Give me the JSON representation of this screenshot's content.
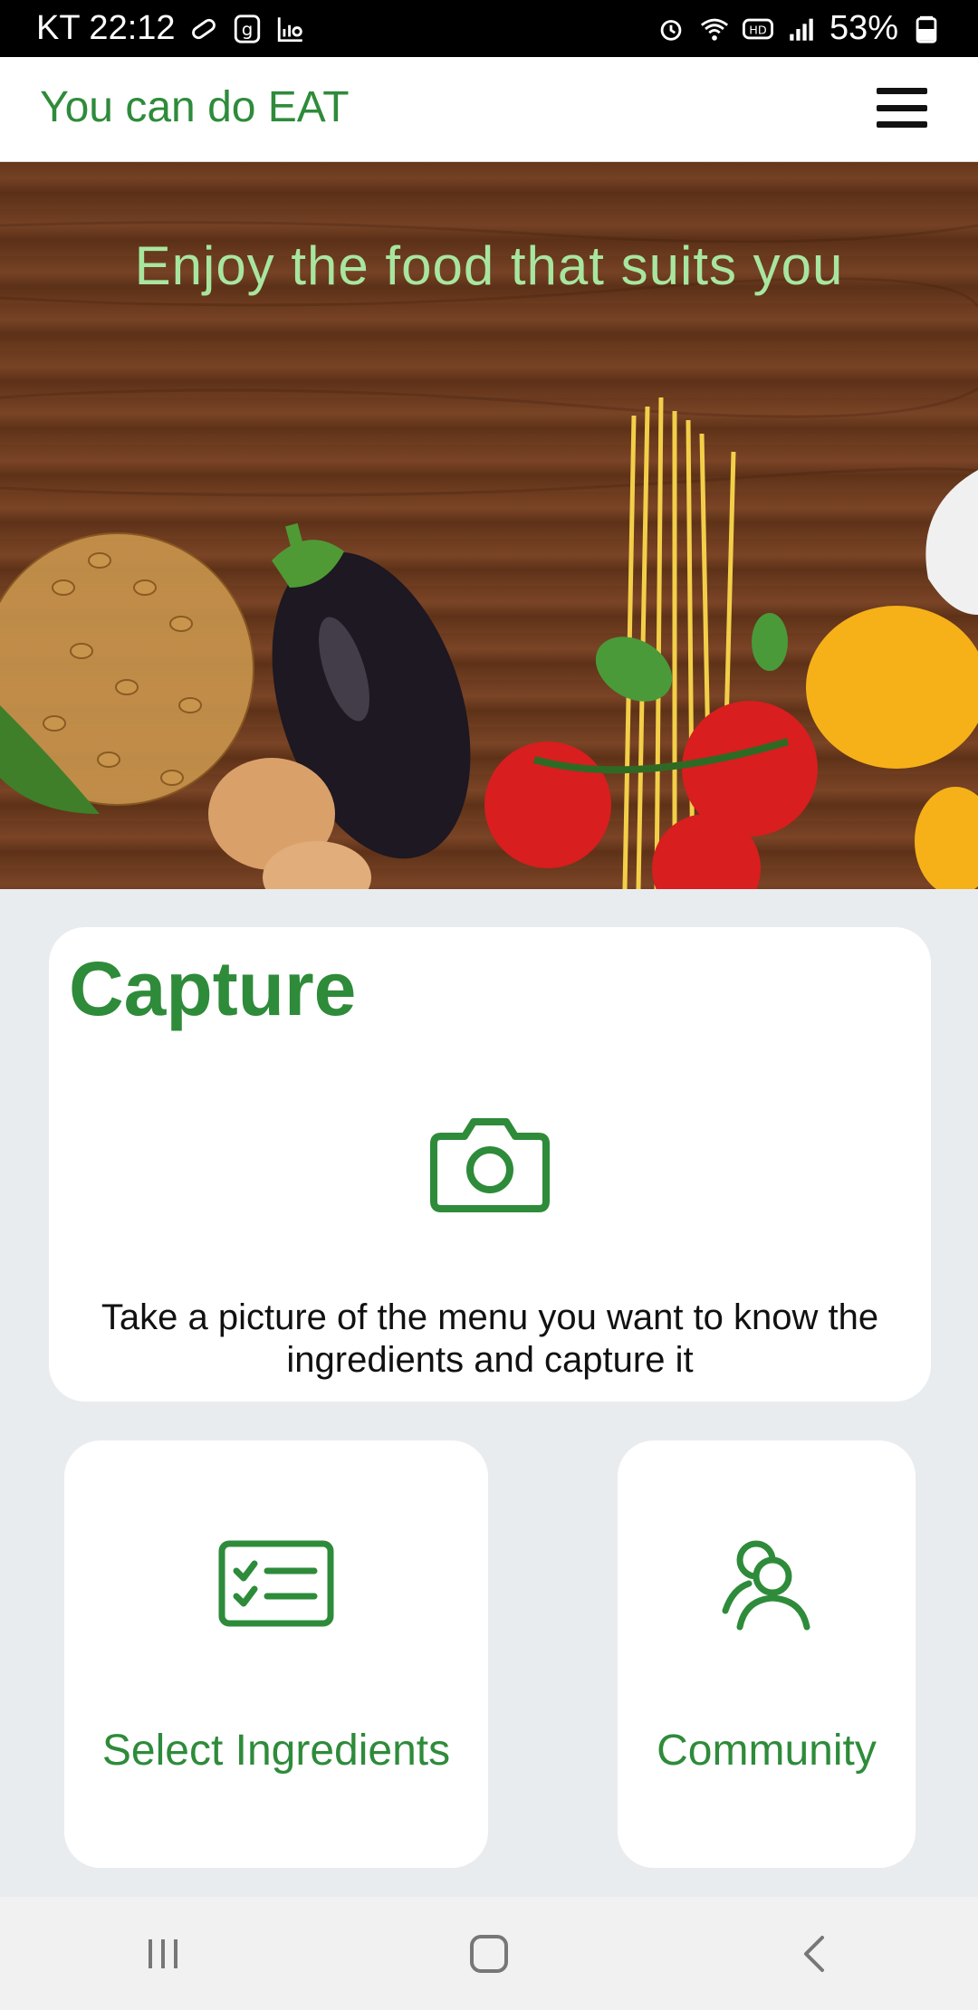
{
  "status_bar": {
    "carrier_time": "KT 22:12",
    "battery": "53%",
    "icons": [
      "pill-icon",
      "g-app-icon",
      "chart-search-icon",
      "alarm-icon",
      "wifi-icon",
      "hd-icon",
      "signal-icon",
      "battery-icon"
    ]
  },
  "app": {
    "title": "You can do EAT",
    "menu_icon": "hamburger-menu-icon"
  },
  "hero": {
    "tagline": "Enjoy the food that suits you"
  },
  "capture": {
    "title": "Capture",
    "icon": "camera-icon",
    "description": "Take a picture of the menu you want to know the ingredients and capture it"
  },
  "cards": {
    "select_ingredients": {
      "label": "Select Ingredients",
      "icon": "checklist-icon"
    },
    "community": {
      "label": "Community",
      "icon": "community-icon"
    }
  },
  "nav": {
    "recents_icon": "recents-icon",
    "home_icon": "home-icon",
    "back_icon": "back-icon"
  },
  "colors": {
    "brand_green": "#2e8b3a",
    "tagline_green": "#a8e6a0",
    "page_bg": "#e9ecef"
  }
}
